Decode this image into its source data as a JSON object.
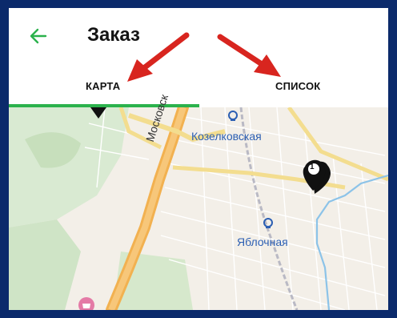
{
  "header": {
    "title": "Заказ",
    "back_icon": "arrow-left-icon",
    "accent_color": "#2bb24c"
  },
  "tabs": [
    {
      "label": "КАРТА",
      "selected": true
    },
    {
      "label": "СПИСОК",
      "selected": false
    }
  ],
  "map": {
    "stations": [
      {
        "label": "Козелковская"
      },
      {
        "label": "Яблочная"
      }
    ],
    "street_label": "Московск",
    "markers": [
      {
        "label": "1"
      }
    ]
  }
}
